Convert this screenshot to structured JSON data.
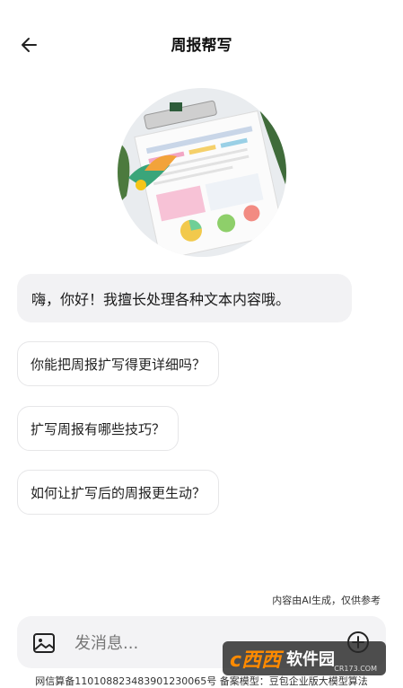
{
  "header": {
    "title": "周报帮写",
    "back_icon": "arrow-left-icon"
  },
  "greeting": "嗨，你好！我擅长处理各种文本内容哦。",
  "suggestions": [
    "你能把周报扩写得更详细吗？",
    "扩写周报有哪些技巧？",
    "如何让扩写后的周报更生动？"
  ],
  "disclaimer": "内容由AI生成，仅供参考",
  "input": {
    "placeholder": "发消息..."
  },
  "watermark": {
    "logo": "c西西",
    "name": "软件园",
    "sub": "CR173.COM"
  },
  "footer": "网信算备110108823483901230065号 备案模型：豆包企业版大模型算法"
}
